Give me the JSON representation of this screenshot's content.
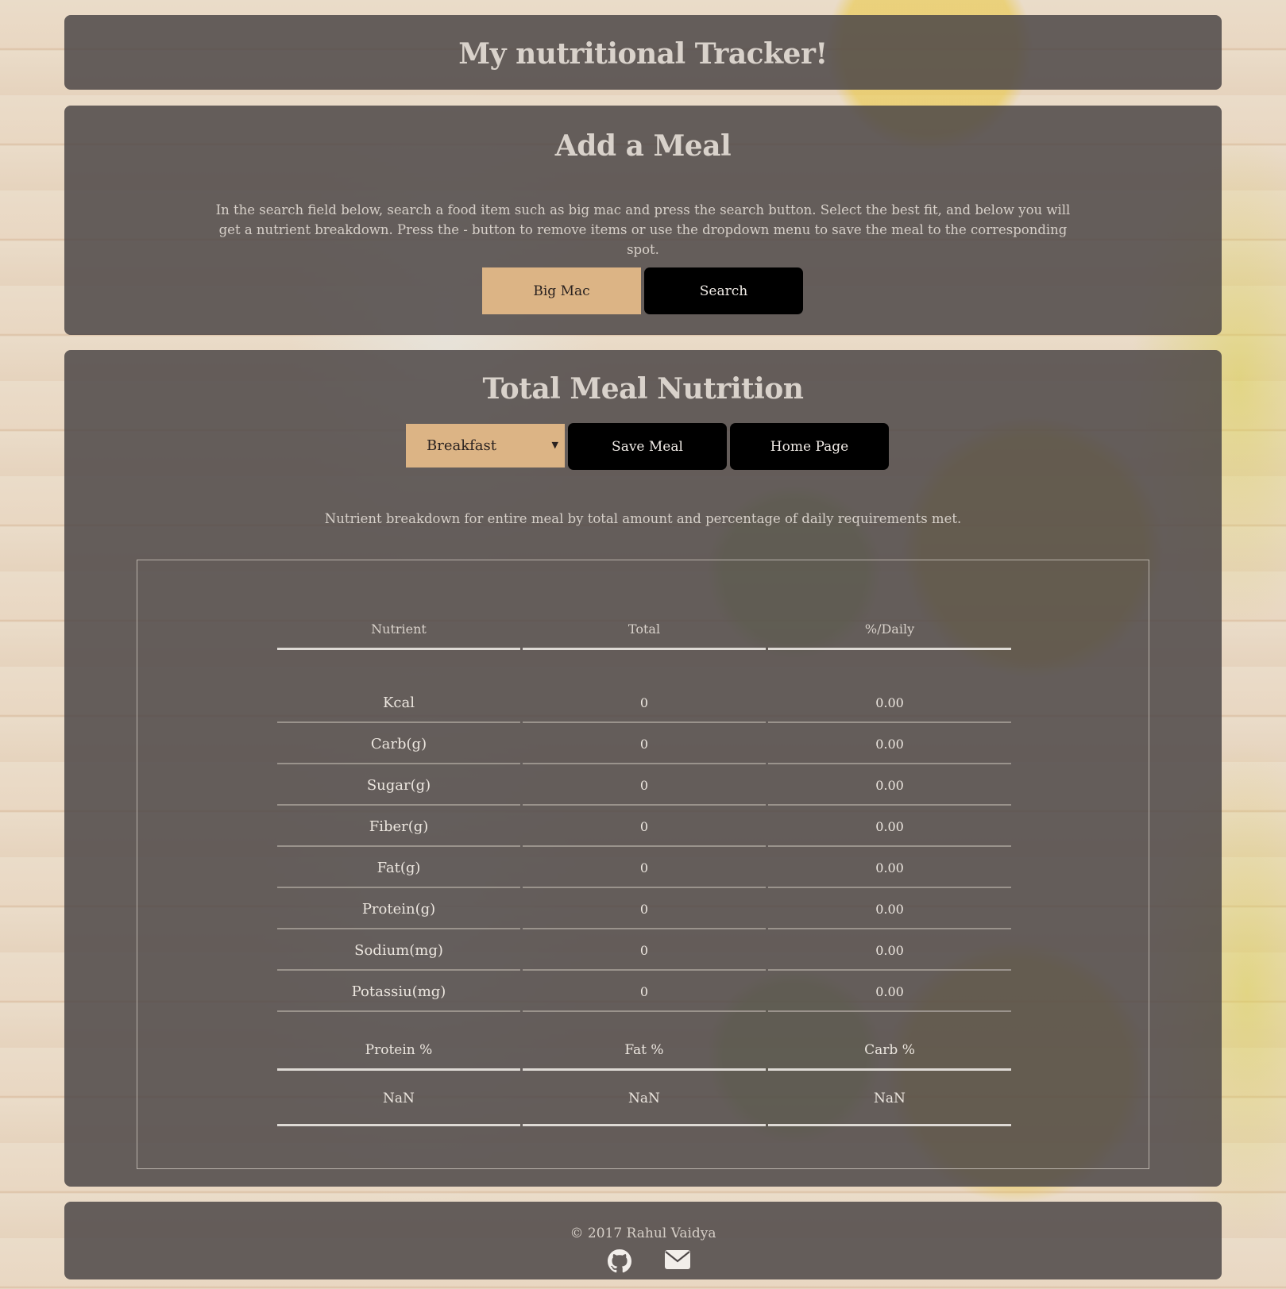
{
  "header": {
    "title": "My nutritional Tracker!"
  },
  "add_meal": {
    "title": "Add a Meal",
    "description": "In the search field below, search a food item such as big mac and press the search button. Select the best fit, and below you will get a nutrient breakdown. Press the - button to remove items or use the dropdown menu to save the meal to the corresponding spot.",
    "search_value": "Big Mac",
    "search_button": "Search"
  },
  "nutrition": {
    "title": "Total Meal Nutrition",
    "meal_select": {
      "selected": "Breakfast"
    },
    "save_button": "Save Meal",
    "home_button": "Home Page",
    "description": "Nutrient breakdown for entire meal by total amount and percentage of daily requirements met.",
    "table": {
      "headers": [
        "Nutrient",
        "Total",
        "%/Daily"
      ],
      "rows": [
        {
          "nutrient": "Kcal",
          "total": "0",
          "daily": "0.00"
        },
        {
          "nutrient": "Carb(g)",
          "total": "0",
          "daily": "0.00"
        },
        {
          "nutrient": "Sugar(g)",
          "total": "0",
          "daily": "0.00"
        },
        {
          "nutrient": "Fiber(g)",
          "total": "0",
          "daily": "0.00"
        },
        {
          "nutrient": "Fat(g)",
          "total": "0",
          "daily": "0.00"
        },
        {
          "nutrient": "Protein(g)",
          "total": "0",
          "daily": "0.00"
        },
        {
          "nutrient": "Sodium(mg)",
          "total": "0",
          "daily": "0.00"
        },
        {
          "nutrient": "Potassiu(mg)",
          "total": "0",
          "daily": "0.00"
        }
      ]
    },
    "macros": {
      "headers": [
        "Protein %",
        "Fat %",
        "Carb %"
      ],
      "values": [
        "NaN",
        "NaN",
        "NaN"
      ]
    }
  },
  "footer": {
    "copyright": "© 2017 Rahul Vaidya",
    "icons": [
      "github-icon",
      "envelope-icon"
    ]
  },
  "colors": {
    "panel": "#4e4848",
    "accent_tan": "#dcb485",
    "button_black": "#000000",
    "text_light": "#d9d2cb"
  }
}
